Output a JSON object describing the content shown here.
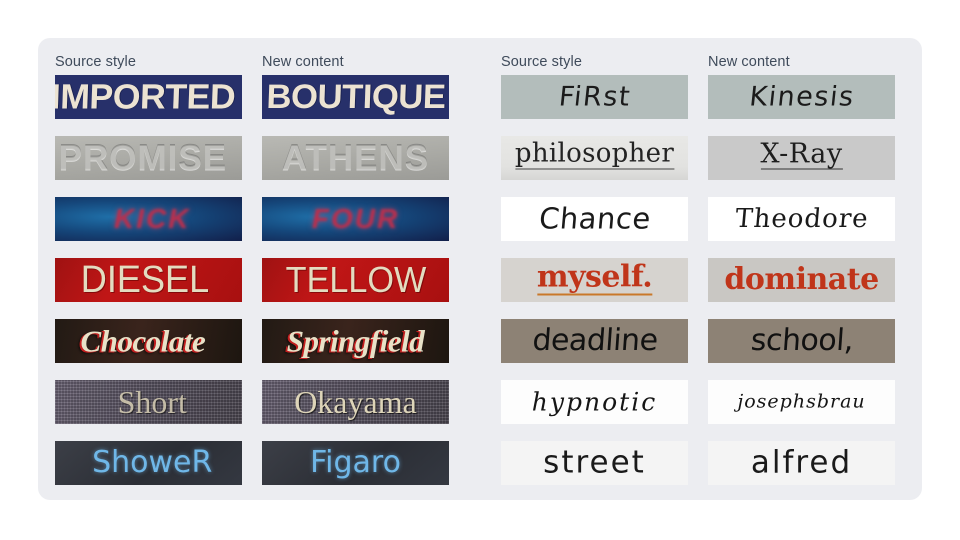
{
  "panel": {
    "left_group": {
      "headers": [
        "Source style",
        "New content"
      ],
      "rows": [
        {
          "source": "IMPORTED",
          "target": "BOUTIQUE",
          "style": "navy-sign"
        },
        {
          "source": "PROMISE",
          "target": "ATHENS",
          "style": "embossed-grey"
        },
        {
          "source": "KICK",
          "target": "FOUR",
          "style": "blurred-neon"
        },
        {
          "source": "DIESEL",
          "target": "TELLOW",
          "style": "red-enamel"
        },
        {
          "source": "Chocolate",
          "target": "Springfield",
          "style": "script-plaque"
        },
        {
          "source": "Short",
          "target": "Okayama",
          "style": "halftone-serif"
        },
        {
          "source": "ShoweR",
          "target": "Figaro",
          "style": "chalk-handwriting"
        }
      ]
    },
    "right_group": {
      "headers": [
        "Source style",
        "New content"
      ],
      "rows": [
        {
          "source": "FiRst",
          "target": "Kinesis",
          "style": "grey-paper-print"
        },
        {
          "source": "philosopher",
          "target": "X-Ray",
          "style": "ruled-notebook"
        },
        {
          "source": "Chance",
          "target": "Theodore",
          "style": "white-cursive"
        },
        {
          "source": "myself.",
          "target": "dominate",
          "style": "red-blackletter"
        },
        {
          "source": "deadline",
          "target": "school,",
          "style": "taupe-marker"
        },
        {
          "source": "hypnotic",
          "target": "josephsbrau",
          "style": "thin-italic"
        },
        {
          "source": "street",
          "target": "alfred",
          "style": "scan-handwriting"
        }
      ]
    }
  },
  "colors": {
    "page_background": "#ffffff",
    "panel_background": "#ecedf1",
    "header_text": "#3f4b5b"
  }
}
